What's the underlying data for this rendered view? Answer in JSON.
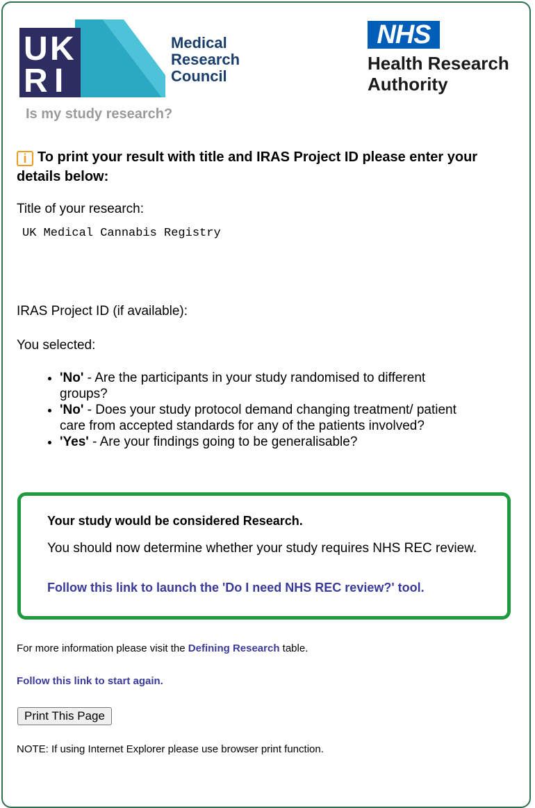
{
  "header": {
    "mrc_lines": [
      "Medical",
      "Research",
      "Council"
    ],
    "ukri_letters": [
      "U",
      "K",
      "R",
      "I"
    ],
    "nhs_label": "NHS",
    "hra_lines": [
      "Health Research",
      "Authority"
    ]
  },
  "app_title": "Is my study research?",
  "instructions": "To print your result with title and IRAS Project ID please enter your details below:",
  "fields": {
    "title_label": "Title of your research:",
    "title_value": "UK Medical Cannabis Registry",
    "iras_label": "IRAS Project ID (if available):",
    "iras_value": ""
  },
  "selected_label": "You selected:",
  "selections": [
    {
      "answer": "'No'",
      "question": " - Are the participants in your study randomised to different groups?"
    },
    {
      "answer": "'No'",
      "question": " - Does your study protocol demand changing treatment/ patient care from accepted standards for any of the patients involved?"
    },
    {
      "answer": "'Yes'",
      "question": " - Are your findings going to be generalisable?"
    }
  ],
  "result": {
    "heading": "Your study would be considered Research.",
    "body": "You should now determine whether your study requires NHS REC review.",
    "link": "Follow this link to launch the 'Do I need NHS REC review?' tool."
  },
  "footer": {
    "more_info_prefix": "For more information please visit the ",
    "more_info_link": "Defining Research",
    "more_info_suffix": " table.",
    "restart_link": "Follow this link to start again.",
    "print_button": "Print This Page",
    "note": "NOTE: If using Internet Explorer please use browser print function."
  },
  "colors": {
    "border": "#2f6e4f",
    "result_border": "#1f9a3f",
    "link": "#3a3a9a",
    "nhs_blue": "#005eb8",
    "ukri_dark": "#2e2d62",
    "ukri_teal": "#2aa8c4",
    "info_icon": "#f29c1f"
  },
  "icons": {
    "info": "info-icon"
  }
}
